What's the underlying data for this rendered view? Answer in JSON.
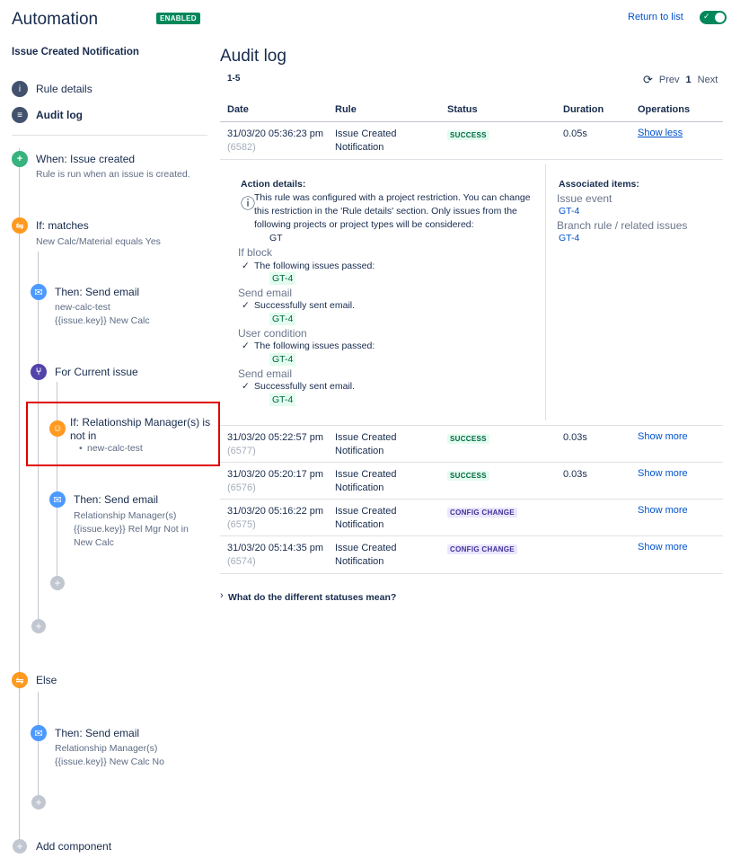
{
  "header": {
    "title": "Automation",
    "enabled_badge": "ENABLED",
    "return_link": "Return to list",
    "toggle_check": "✓"
  },
  "sidebar": {
    "rule_name": "Issue Created Notification",
    "nav": [
      {
        "label": "Rule details",
        "icon": "info-icon"
      },
      {
        "label": "Audit log",
        "icon": "list-icon"
      }
    ]
  },
  "flow": {
    "trigger": {
      "title": "When: Issue created",
      "desc": "Rule is run when an issue is created."
    },
    "if_matches": {
      "title": "If: matches",
      "desc": "New Calc/Material equals Yes"
    },
    "send_email_1": {
      "title": "Then: Send email",
      "line1": "new-calc-test",
      "line2": "{{issue.key}} New Calc"
    },
    "for_current": {
      "title": "For Current issue"
    },
    "if_relationship": {
      "title1": "If: Relationship Manager(s) is",
      "title2": "not in",
      "bullet": "•",
      "value": "new-calc-test"
    },
    "send_email_2": {
      "title": "Then: Send email",
      "line1": "Relationship Manager(s)",
      "line2": "{{issue.key}} Rel Mgr Not in",
      "line3": "New Calc"
    },
    "else": {
      "title": "Else"
    },
    "send_email_3": {
      "title": "Then: Send email",
      "line1": "Relationship Manager(s)",
      "line2": "{{issue.key}} New Calc No"
    },
    "add_component": "Add component",
    "plus": "+"
  },
  "main": {
    "title": "Audit log",
    "range": "1-5",
    "pager": {
      "refresh": "⟳",
      "prev": "Prev",
      "page": "1",
      "next": "Next"
    },
    "columns": [
      "Date",
      "Rule",
      "Status",
      "Duration",
      "Operations"
    ],
    "rows": [
      {
        "date": "31/03/20 05:36:23 pm",
        "id": "(6582)",
        "rule1": "Issue Created",
        "rule2": "Notification",
        "status": "SUCCESS",
        "duration": "0.05s",
        "op": "Show less"
      },
      {
        "date": "31/03/20 05:22:57 pm",
        "id": "(6577)",
        "rule1": "Issue Created",
        "rule2": "Notification",
        "status": "SUCCESS",
        "duration": "0.03s",
        "op": "Show more"
      },
      {
        "date": "31/03/20 05:20:17 pm",
        "id": "(6576)",
        "rule1": "Issue Created",
        "rule2": "Notification",
        "status": "SUCCESS",
        "duration": "0.03s",
        "op": "Show more"
      },
      {
        "date": "31/03/20 05:16:22 pm",
        "id": "(6575)",
        "rule1": "Issue Created",
        "rule2": "Notification",
        "status": "CONFIG CHANGE",
        "duration": "",
        "op": "Show more"
      },
      {
        "date": "31/03/20 05:14:35 pm",
        "id": "(6574)",
        "rule1": "Issue Created",
        "rule2": "Notification",
        "status": "CONFIG CHANGE",
        "duration": "",
        "op": "Show more"
      }
    ],
    "details": {
      "action_label": "Action details:",
      "info_icon": "ⓘ",
      "restriction_1": "This rule was configured with a project restriction. You can change",
      "restriction_2": "this restriction in the 'Rule details' section. Only issues from the",
      "restriction_3": "following projects or project types will be considered:",
      "project": "GT",
      "if_block": "If block",
      "passed_1": "The following issues passed:",
      "send_email_a": "Send email",
      "sent_1": "Successfully sent email.",
      "user_condition": "User condition",
      "passed_2": "The following issues passed:",
      "send_email_b": "Send email",
      "sent_2": "Successfully sent email.",
      "issue": "GT-4",
      "check": "✓",
      "assoc_label": "Associated items:",
      "issue_event": "Issue event",
      "branch_rule": "Branch rule / related issues"
    },
    "faq": "What do the different statuses mean?",
    "faq_chevron": "›"
  }
}
